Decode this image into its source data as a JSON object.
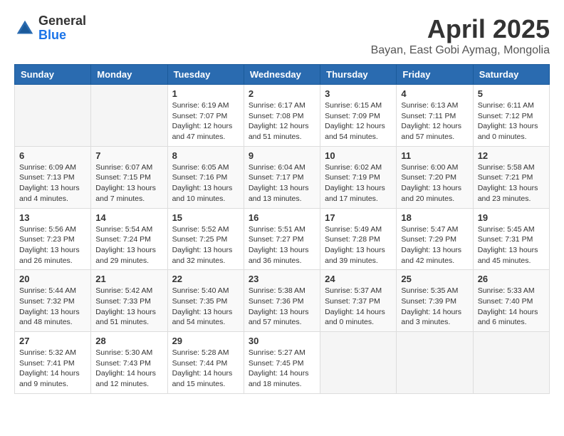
{
  "logo": {
    "general": "General",
    "blue": "Blue"
  },
  "title": "April 2025",
  "location": "Bayan, East Gobi Aymag, Mongolia",
  "days_header": [
    "Sunday",
    "Monday",
    "Tuesday",
    "Wednesday",
    "Thursday",
    "Friday",
    "Saturday"
  ],
  "weeks": [
    [
      {
        "day": "",
        "sunrise": "",
        "sunset": "",
        "daylight": ""
      },
      {
        "day": "",
        "sunrise": "",
        "sunset": "",
        "daylight": ""
      },
      {
        "day": "1",
        "sunrise": "Sunrise: 6:19 AM",
        "sunset": "Sunset: 7:07 PM",
        "daylight": "Daylight: 12 hours and 47 minutes."
      },
      {
        "day": "2",
        "sunrise": "Sunrise: 6:17 AM",
        "sunset": "Sunset: 7:08 PM",
        "daylight": "Daylight: 12 hours and 51 minutes."
      },
      {
        "day": "3",
        "sunrise": "Sunrise: 6:15 AM",
        "sunset": "Sunset: 7:09 PM",
        "daylight": "Daylight: 12 hours and 54 minutes."
      },
      {
        "day": "4",
        "sunrise": "Sunrise: 6:13 AM",
        "sunset": "Sunset: 7:11 PM",
        "daylight": "Daylight: 12 hours and 57 minutes."
      },
      {
        "day": "5",
        "sunrise": "Sunrise: 6:11 AM",
        "sunset": "Sunset: 7:12 PM",
        "daylight": "Daylight: 13 hours and 0 minutes."
      }
    ],
    [
      {
        "day": "6",
        "sunrise": "Sunrise: 6:09 AM",
        "sunset": "Sunset: 7:13 PM",
        "daylight": "Daylight: 13 hours and 4 minutes."
      },
      {
        "day": "7",
        "sunrise": "Sunrise: 6:07 AM",
        "sunset": "Sunset: 7:15 PM",
        "daylight": "Daylight: 13 hours and 7 minutes."
      },
      {
        "day": "8",
        "sunrise": "Sunrise: 6:05 AM",
        "sunset": "Sunset: 7:16 PM",
        "daylight": "Daylight: 13 hours and 10 minutes."
      },
      {
        "day": "9",
        "sunrise": "Sunrise: 6:04 AM",
        "sunset": "Sunset: 7:17 PM",
        "daylight": "Daylight: 13 hours and 13 minutes."
      },
      {
        "day": "10",
        "sunrise": "Sunrise: 6:02 AM",
        "sunset": "Sunset: 7:19 PM",
        "daylight": "Daylight: 13 hours and 17 minutes."
      },
      {
        "day": "11",
        "sunrise": "Sunrise: 6:00 AM",
        "sunset": "Sunset: 7:20 PM",
        "daylight": "Daylight: 13 hours and 20 minutes."
      },
      {
        "day": "12",
        "sunrise": "Sunrise: 5:58 AM",
        "sunset": "Sunset: 7:21 PM",
        "daylight": "Daylight: 13 hours and 23 minutes."
      }
    ],
    [
      {
        "day": "13",
        "sunrise": "Sunrise: 5:56 AM",
        "sunset": "Sunset: 7:23 PM",
        "daylight": "Daylight: 13 hours and 26 minutes."
      },
      {
        "day": "14",
        "sunrise": "Sunrise: 5:54 AM",
        "sunset": "Sunset: 7:24 PM",
        "daylight": "Daylight: 13 hours and 29 minutes."
      },
      {
        "day": "15",
        "sunrise": "Sunrise: 5:52 AM",
        "sunset": "Sunset: 7:25 PM",
        "daylight": "Daylight: 13 hours and 32 minutes."
      },
      {
        "day": "16",
        "sunrise": "Sunrise: 5:51 AM",
        "sunset": "Sunset: 7:27 PM",
        "daylight": "Daylight: 13 hours and 36 minutes."
      },
      {
        "day": "17",
        "sunrise": "Sunrise: 5:49 AM",
        "sunset": "Sunset: 7:28 PM",
        "daylight": "Daylight: 13 hours and 39 minutes."
      },
      {
        "day": "18",
        "sunrise": "Sunrise: 5:47 AM",
        "sunset": "Sunset: 7:29 PM",
        "daylight": "Daylight: 13 hours and 42 minutes."
      },
      {
        "day": "19",
        "sunrise": "Sunrise: 5:45 AM",
        "sunset": "Sunset: 7:31 PM",
        "daylight": "Daylight: 13 hours and 45 minutes."
      }
    ],
    [
      {
        "day": "20",
        "sunrise": "Sunrise: 5:44 AM",
        "sunset": "Sunset: 7:32 PM",
        "daylight": "Daylight: 13 hours and 48 minutes."
      },
      {
        "day": "21",
        "sunrise": "Sunrise: 5:42 AM",
        "sunset": "Sunset: 7:33 PM",
        "daylight": "Daylight: 13 hours and 51 minutes."
      },
      {
        "day": "22",
        "sunrise": "Sunrise: 5:40 AM",
        "sunset": "Sunset: 7:35 PM",
        "daylight": "Daylight: 13 hours and 54 minutes."
      },
      {
        "day": "23",
        "sunrise": "Sunrise: 5:38 AM",
        "sunset": "Sunset: 7:36 PM",
        "daylight": "Daylight: 13 hours and 57 minutes."
      },
      {
        "day": "24",
        "sunrise": "Sunrise: 5:37 AM",
        "sunset": "Sunset: 7:37 PM",
        "daylight": "Daylight: 14 hours and 0 minutes."
      },
      {
        "day": "25",
        "sunrise": "Sunrise: 5:35 AM",
        "sunset": "Sunset: 7:39 PM",
        "daylight": "Daylight: 14 hours and 3 minutes."
      },
      {
        "day": "26",
        "sunrise": "Sunrise: 5:33 AM",
        "sunset": "Sunset: 7:40 PM",
        "daylight": "Daylight: 14 hours and 6 minutes."
      }
    ],
    [
      {
        "day": "27",
        "sunrise": "Sunrise: 5:32 AM",
        "sunset": "Sunset: 7:41 PM",
        "daylight": "Daylight: 14 hours and 9 minutes."
      },
      {
        "day": "28",
        "sunrise": "Sunrise: 5:30 AM",
        "sunset": "Sunset: 7:43 PM",
        "daylight": "Daylight: 14 hours and 12 minutes."
      },
      {
        "day": "29",
        "sunrise": "Sunrise: 5:28 AM",
        "sunset": "Sunset: 7:44 PM",
        "daylight": "Daylight: 14 hours and 15 minutes."
      },
      {
        "day": "30",
        "sunrise": "Sunrise: 5:27 AM",
        "sunset": "Sunset: 7:45 PM",
        "daylight": "Daylight: 14 hours and 18 minutes."
      },
      {
        "day": "",
        "sunrise": "",
        "sunset": "",
        "daylight": ""
      },
      {
        "day": "",
        "sunrise": "",
        "sunset": "",
        "daylight": ""
      },
      {
        "day": "",
        "sunrise": "",
        "sunset": "",
        "daylight": ""
      }
    ]
  ]
}
